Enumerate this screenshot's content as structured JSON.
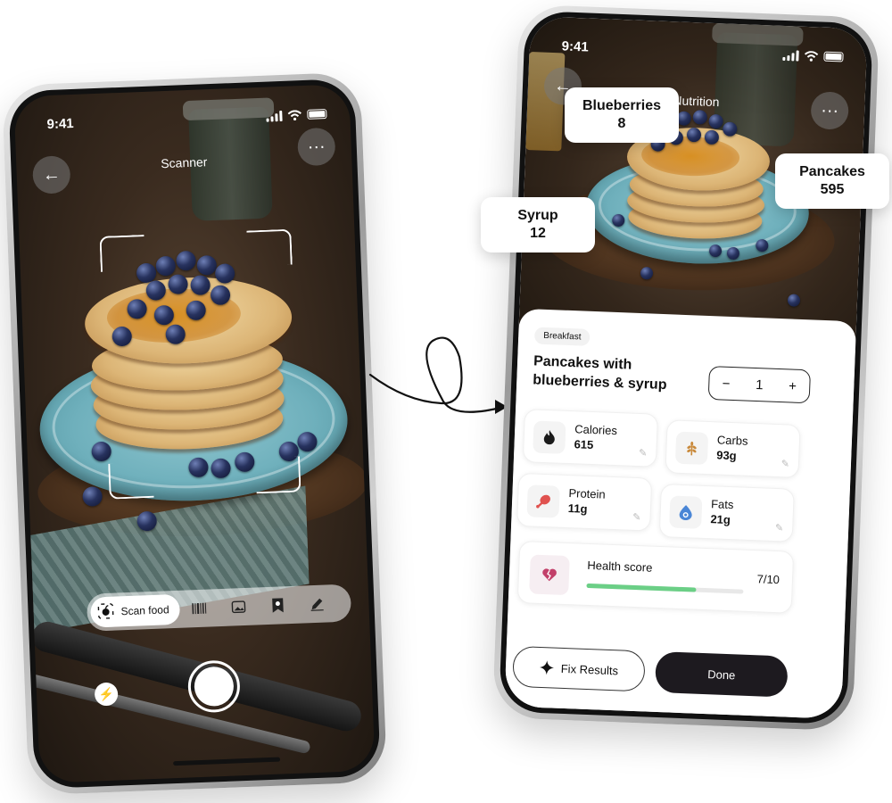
{
  "scanner": {
    "status_time": "9:41",
    "title": "Scanner",
    "back_icon": "arrow-left-icon",
    "more_label": "···",
    "tools": {
      "active_label": "Scan food",
      "items": [
        "barcode-icon",
        "gallery-icon",
        "label-icon",
        "pen-icon"
      ]
    },
    "flash_icon": "flash-icon"
  },
  "nutrition": {
    "status_time": "9:41",
    "title": "Nutrition",
    "more_label": "···",
    "chip": "Breakfast",
    "meal_name": "Pancakes with blueberries & syrup",
    "quantity": {
      "minus": "−",
      "value": "1",
      "plus": "+"
    },
    "metrics": [
      {
        "label": "Calories",
        "value": "615",
        "icon": "flame-icon",
        "icon_color": "#1a1a1a"
      },
      {
        "label": "Carbs",
        "value": "93g",
        "icon": "wheat-icon",
        "icon_color": "#c9893a"
      },
      {
        "label": "Protein",
        "value": "11g",
        "icon": "drumstick-icon",
        "icon_color": "#e0524f"
      },
      {
        "label": "Fats",
        "value": "21g",
        "icon": "avocado-icon",
        "icon_color": "#4a86d6"
      }
    ],
    "health": {
      "label": "Health score",
      "value": "7/10",
      "fraction": 0.7,
      "fill_color": "#6bcf86"
    },
    "fix_label": "Fix Results",
    "done_label": "Done"
  },
  "callouts": {
    "blueberries": {
      "name": "Blueberries",
      "value": "8"
    },
    "pancakes": {
      "name": "Pancakes",
      "value": "595"
    },
    "syrup": {
      "name": "Syrup",
      "value": "12"
    }
  }
}
